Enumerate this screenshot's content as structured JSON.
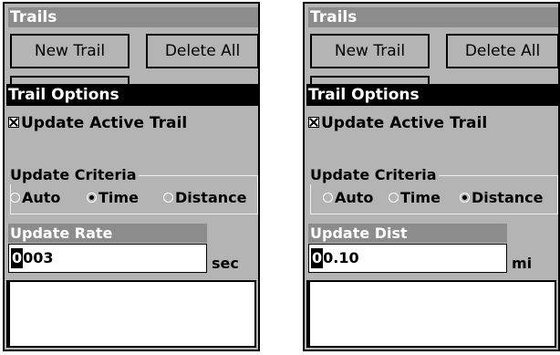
{
  "screens": [
    {
      "title": "Trails",
      "buttons": {
        "new_trail": "New Trail",
        "delete_all": "Delete All"
      },
      "dialog_title": "Trail Options",
      "checkbox_label": "Update Active Trail",
      "criteria_label": "Update Criteria",
      "radios": [
        "Auto",
        "Time",
        "Distance"
      ],
      "selected_radio": "Time",
      "field_label": "Update Rate",
      "field_cursor": "0",
      "field_value_rest": "003",
      "unit": "sec"
    },
    {
      "title": "Trails",
      "buttons": {
        "new_trail": "New Trail",
        "delete_all": "Delete All"
      },
      "dialog_title": "Trail Options",
      "checkbox_label": "Update Active Trail",
      "criteria_label": "Update Criteria",
      "radios": [
        "Auto",
        "Time",
        "Distance"
      ],
      "selected_radio": "Distance",
      "field_label": "Update Dist",
      "field_cursor": "0",
      "field_value_rest": "0.10",
      "unit": "mi"
    }
  ]
}
